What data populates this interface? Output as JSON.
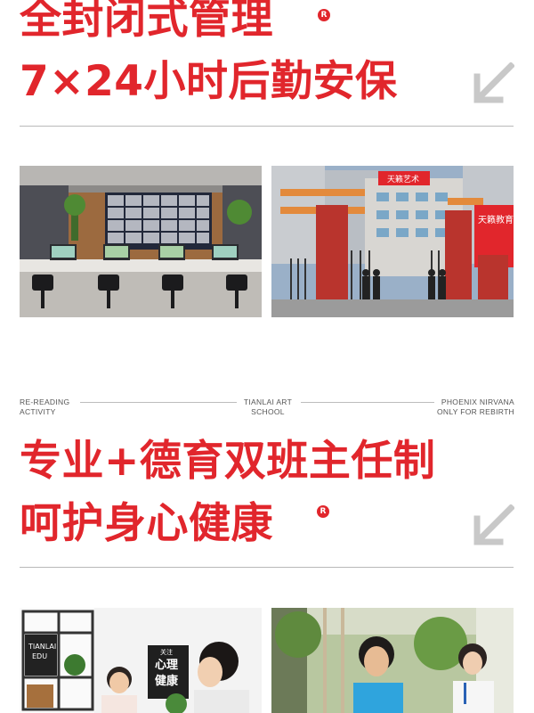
{
  "section1": {
    "title_line1": "全封闭式管理",
    "title_line2": "7×24小时后勤安保",
    "reg_mark": "R",
    "arrow_icon": "arrow-down-left-icon",
    "photos": {
      "control_room": {
        "description_icon": "monitoring-control-room-photo"
      },
      "school_gate": {
        "sign_top": "天籁艺术",
        "sign_side": "天籁教育"
      }
    }
  },
  "tagline": {
    "left_line1": "RE-READING",
    "left_line2": "ACTIVITY",
    "center_line1": "TIANLAI ART",
    "center_line2": "SCHOOL",
    "right_line1": "PHOENIX NIRVANA",
    "right_line2": "ONLY FOR REBIRTH"
  },
  "section2": {
    "title_line1": "专业+德育双班主任制",
    "title_line2": "呵护身心健康",
    "reg_mark": "R",
    "arrow_icon": "arrow-down-left-icon",
    "photos": {
      "counseling": {
        "logo_line1": "TIANLAI",
        "logo_line2": "EDU",
        "poster_small": "关注",
        "poster_line1": "心理",
        "poster_line2": "健康"
      },
      "teachers": {}
    }
  },
  "colors": {
    "accent": "#e1262c",
    "arrow": "#c8c8c8",
    "rule": "#b9b9b9"
  }
}
